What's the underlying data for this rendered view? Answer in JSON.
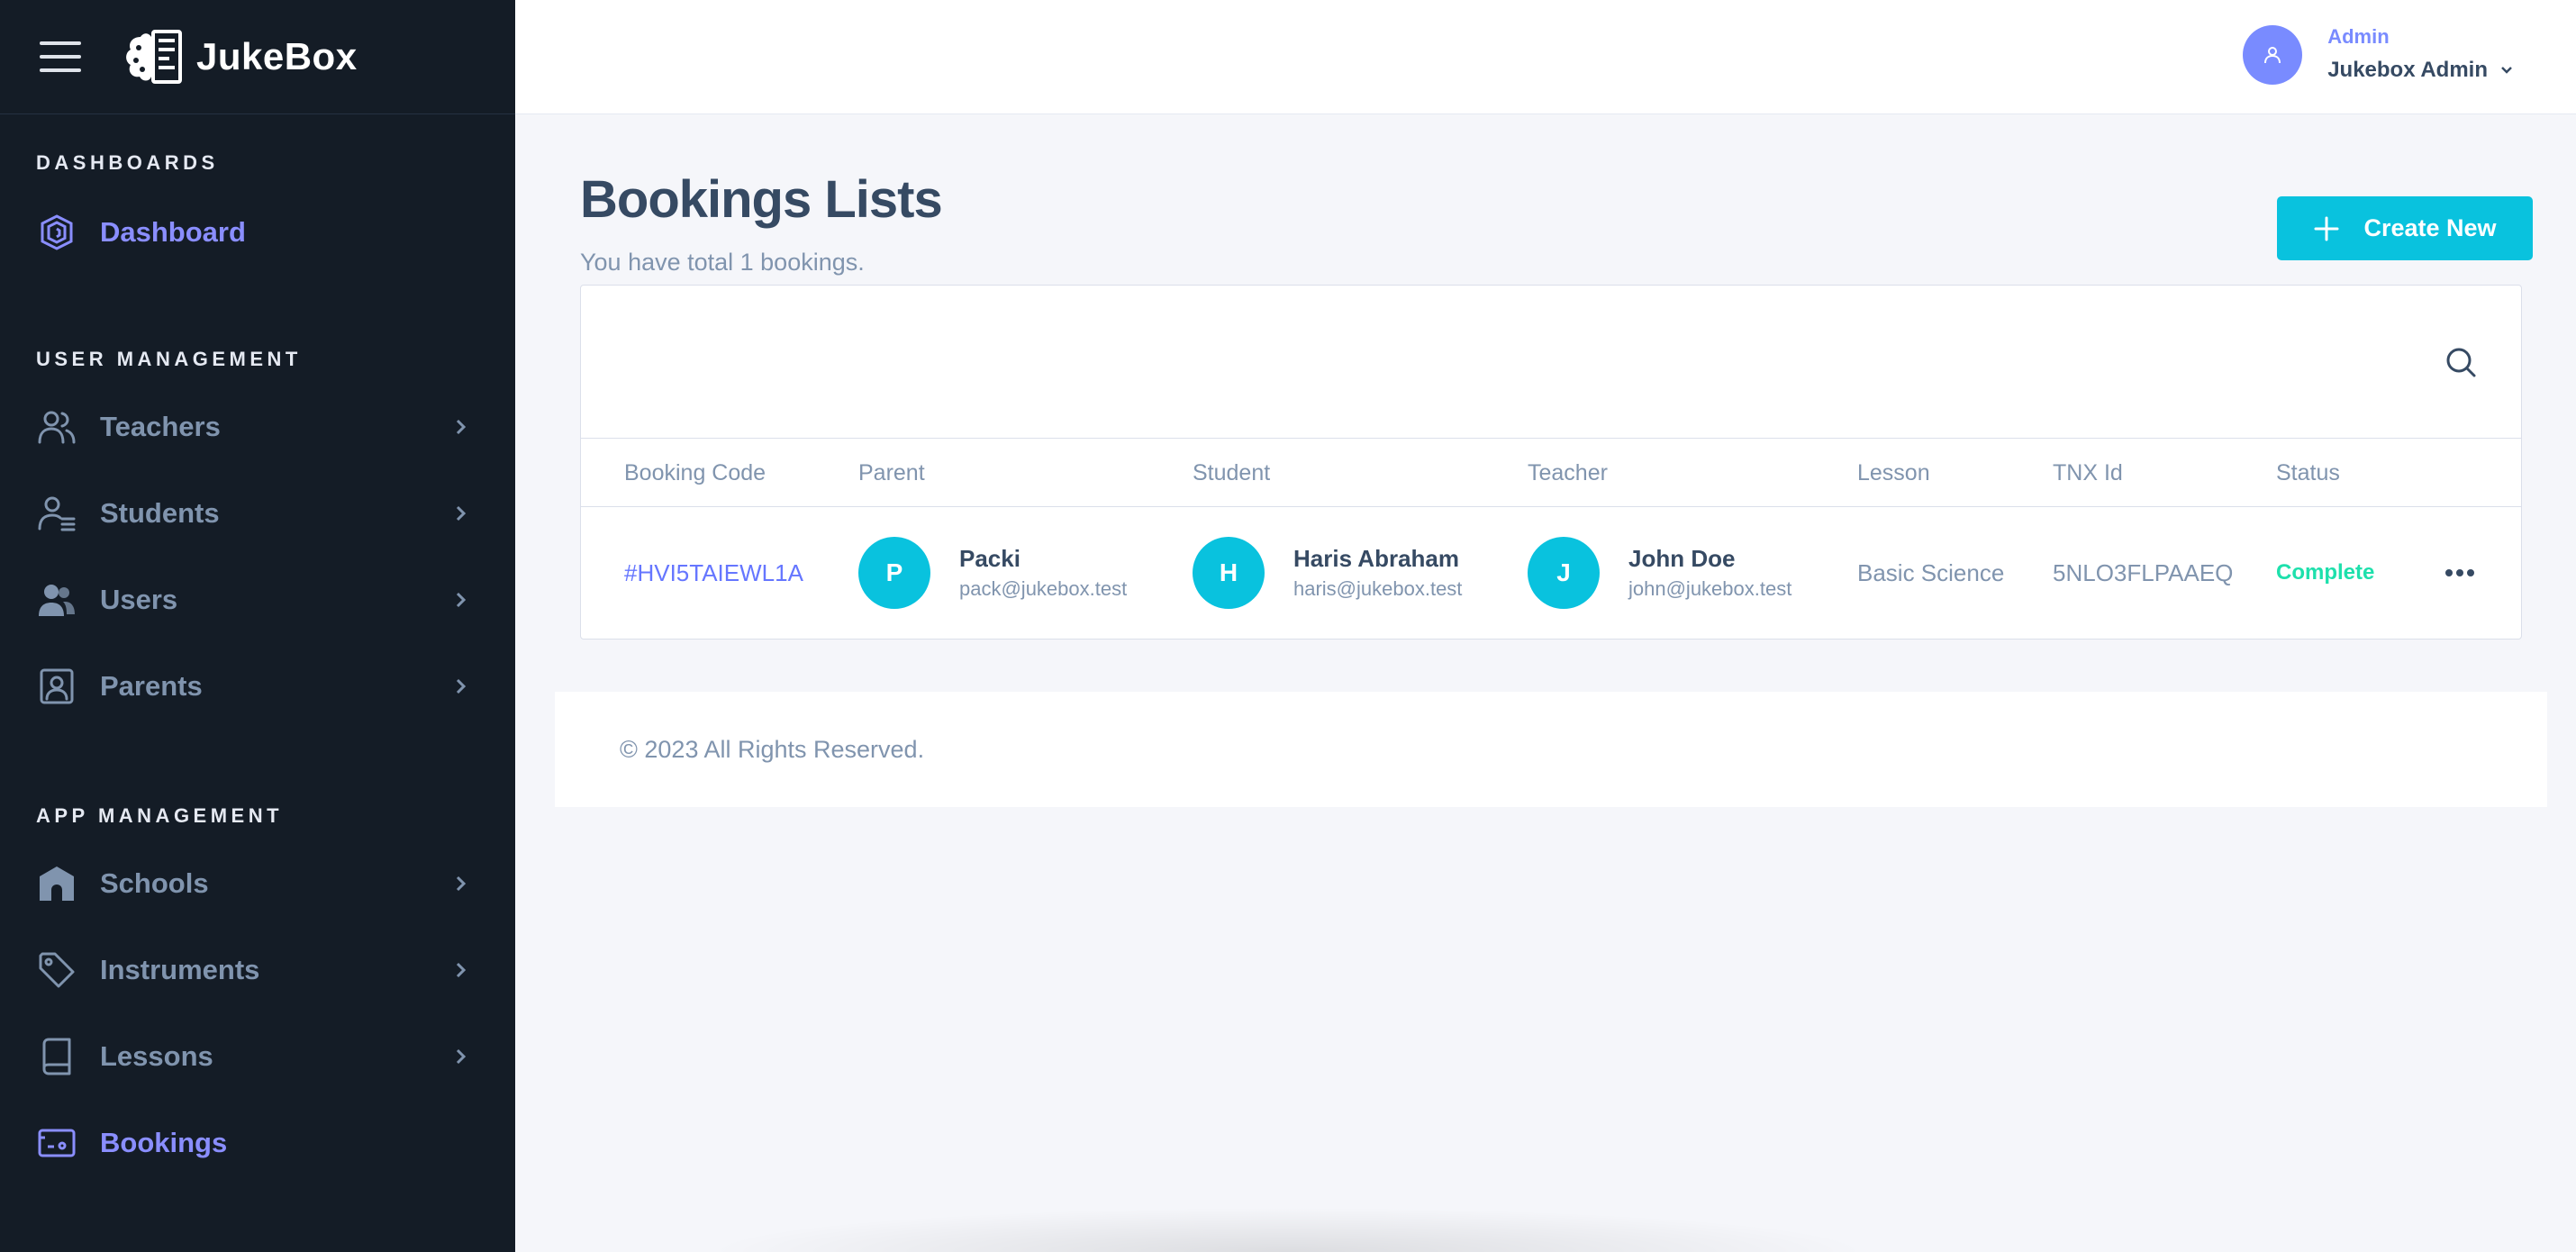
{
  "brand": {
    "name": "JukeBox"
  },
  "sidebar": {
    "sections": [
      {
        "heading": "DASHBOARDS"
      },
      {
        "heading": "USER MANAGEMENT"
      },
      {
        "heading": "APP MANAGEMENT"
      }
    ],
    "items": [
      {
        "label": "Dashboard",
        "icon": "dashboard-icon"
      },
      {
        "label": "Teachers",
        "icon": "users-icon"
      },
      {
        "label": "Students",
        "icon": "user-list-icon"
      },
      {
        "label": "Users",
        "icon": "user-group-icon"
      },
      {
        "label": "Parents",
        "icon": "contact-icon"
      },
      {
        "label": "Schools",
        "icon": "school-icon"
      },
      {
        "label": "Instruments",
        "icon": "tag-icon"
      },
      {
        "label": "Lessons",
        "icon": "book-icon"
      },
      {
        "label": "Bookings",
        "icon": "ticket-icon"
      }
    ],
    "active_color": "#8a8eff",
    "background": "#141c26"
  },
  "topbar": {
    "user": {
      "role": "Admin",
      "name": "Jukebox Admin"
    }
  },
  "page": {
    "title": "Bookings Lists",
    "subtitle": "You have total 1 bookings.",
    "create_button": "Create New"
  },
  "table": {
    "headers": [
      "Booking Code",
      "Parent",
      "Student",
      "Teacher",
      "Lesson",
      "TNX Id",
      "Status"
    ],
    "rows": [
      {
        "code": "#HVI5TAIEWL1A",
        "parent": {
          "initial": "P",
          "name": "Packi",
          "email": "pack@jukebox.test"
        },
        "student": {
          "initial": "H",
          "name": "Haris Abraham",
          "email": "haris@jukebox.test"
        },
        "teacher": {
          "initial": "J",
          "name": "John Doe",
          "email": "john@jukebox.test"
        },
        "lesson": "Basic Science",
        "tnx": "5NLO3FLPAAEQ",
        "status": "Complete"
      }
    ]
  },
  "footer": {
    "text": "© 2023 All Rights Reserved."
  },
  "colors": {
    "accent": "#09c2de",
    "status_complete": "#1ee0ac",
    "link": "#6576ff"
  }
}
